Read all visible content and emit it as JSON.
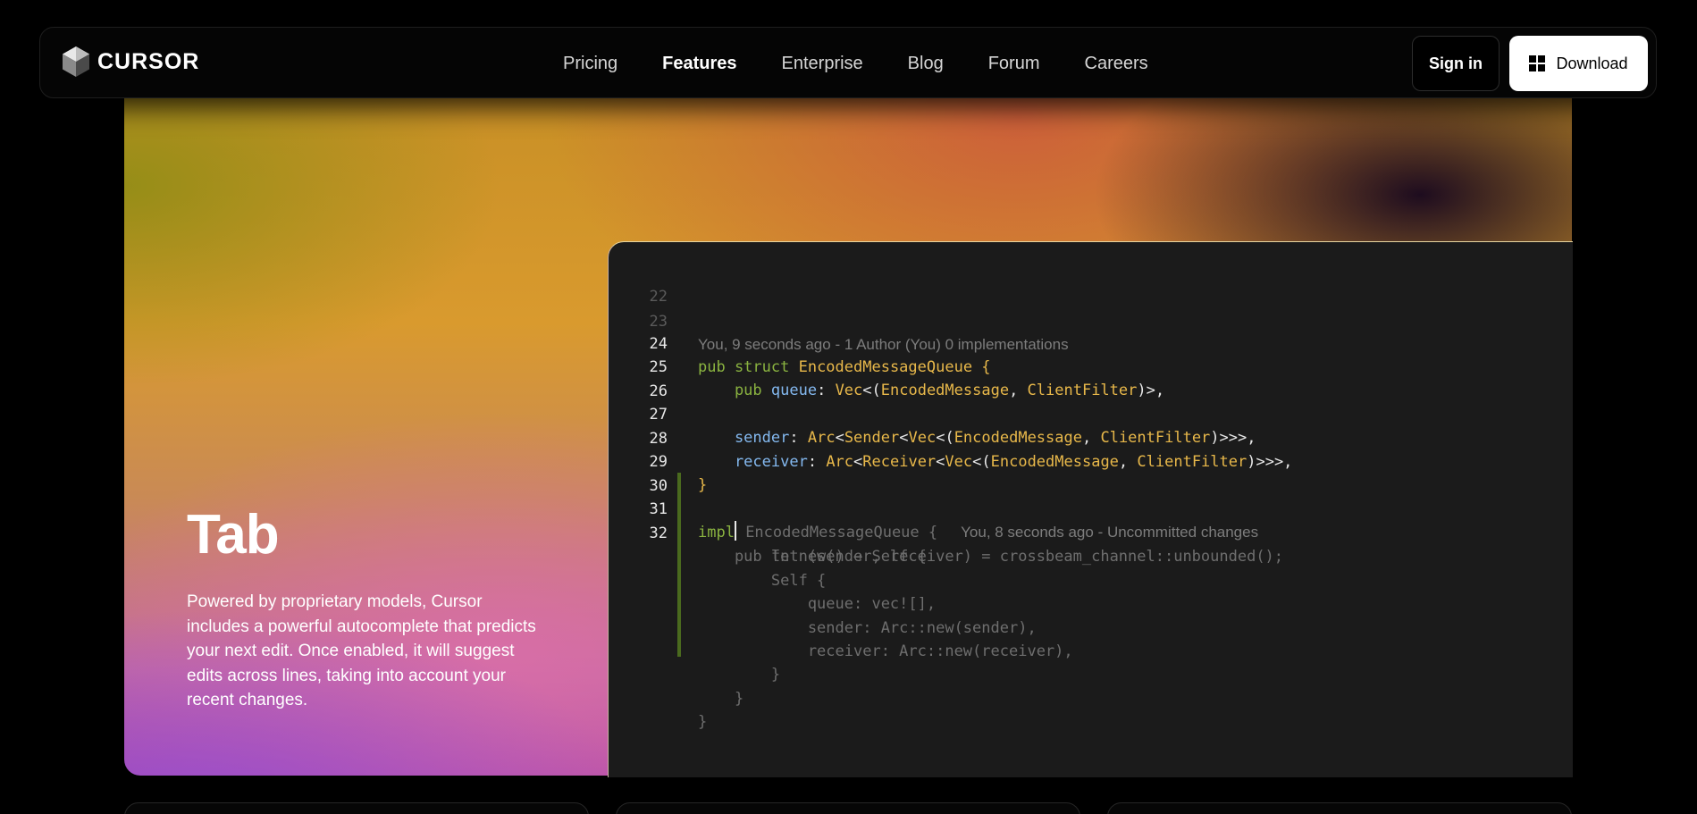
{
  "nav": {
    "brand": "CURSOR",
    "links": [
      "Pricing",
      "Features",
      "Enterprise",
      "Blog",
      "Forum",
      "Careers"
    ],
    "active_link": "Features",
    "sign_in": "Sign in",
    "download": "Download"
  },
  "hero": {
    "title": "Tab",
    "description": "Powered by proprietary models, Cursor includes a powerful autocomplete that predicts your next edit. Once enabled, it will suggest edits across lines, taking into account your recent changes."
  },
  "editor": {
    "line_numbers": [
      "22",
      "23",
      "24",
      "25",
      "26",
      "27",
      "28",
      "29",
      "30",
      "31",
      "32"
    ],
    "blame_top": "You, 9 seconds ago - 1 Author (You) 0 implementations",
    "blame_inline": "You, 8 seconds ago - Uncommitted changes",
    "code": {
      "l24_kw": "pub struct ",
      "l24_type": "EncodedMessageQueue",
      "l24_end": " {",
      "l25_kw": "    pub ",
      "l25_field": "queue",
      "l25_a": ": ",
      "l25_t1": "Vec",
      "l25_b": "<(",
      "l25_t2": "EncodedMessage",
      "l25_c": ", ",
      "l25_t3": "ClientFilter",
      "l25_d": ")>,",
      "l27_field": "    sender",
      "l27_a": ": ",
      "l27_t1": "Arc",
      "l27_b": "<",
      "l27_t2": "Sender",
      "l27_c": "<",
      "l27_t3": "Vec",
      "l27_d": "<(",
      "l27_t4": "EncodedMessage",
      "l27_e": ", ",
      "l27_t5": "ClientFilter",
      "l27_f": ")>>>,",
      "l28_field": "    receiver",
      "l28_a": ": ",
      "l28_t1": "Arc",
      "l28_b": "<",
      "l28_t2": "Receiver",
      "l28_c": "<",
      "l28_t3": "Vec",
      "l28_d": "<(",
      "l28_t4": "EncodedMessage",
      "l28_e": ", ",
      "l28_t5": "ClientFilter",
      "l28_f": ")>>>,",
      "l29": "}",
      "l31_kw": "impl",
      "l31_ghost": " EncodedMessageQueue {",
      "ghost_lines": [
        "    pub fn new() → Self {",
        "        let (sender, receiver) = crossbeam_channel::unbounded();",
        "        Self {",
        "            queue: vec![],",
        "            sender: Arc::new(sender),",
        "            receiver: Arc::new(receiver),",
        "        }",
        "    }",
        "}"
      ]
    }
  },
  "icons": {
    "brand_logo": "cube-logo-icon",
    "download": "windows-icon"
  }
}
